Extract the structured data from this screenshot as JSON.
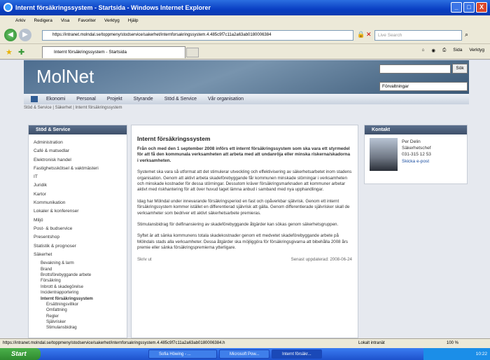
{
  "window": {
    "title": "Internt försäkringssystem - Startsida - Windows Internet Explorer",
    "buttons": [
      "_",
      "□",
      "X"
    ]
  },
  "menu": [
    "Arkiv",
    "Redigera",
    "Visa",
    "Favoriter",
    "Verktyg",
    "Hjälp"
  ],
  "address": {
    "url": "https://intranet.molndal.se/toppmeny/stodservice/sakerhet/internforsakringssystem.4.485c9f7c11a2a63ab0180006384",
    "search_placeholder": "Live Search"
  },
  "tab": {
    "title": "Internt försäkringssystem - Startsida"
  },
  "tools": [
    "Sida",
    "Verktyg"
  ],
  "site": {
    "logo": "MolNet",
    "search_button": "Sök",
    "dropdown": "Förvaltningar",
    "nav": [
      "Ekonomi",
      "Personal",
      "Projekt",
      "Styrande",
      "Stöd & Service",
      "Vår organisation"
    ],
    "breadcrumb": "Stöd & Service | Säkerhet | Internt försäkringssystem"
  },
  "left": {
    "heading": "Stöd & Service",
    "items": [
      "Administration",
      "Café & matsedlar",
      "Elektronisk handel",
      "Fastighetsskötsel & vaktmästeri",
      "IT",
      "Juridik",
      "Kartor",
      "Kommunikation",
      "Lokaler & konferenser",
      "Miljö",
      "Post- & budservice",
      "Presentshop",
      "Statistik & prognoser",
      "Säkerhet"
    ],
    "sub": [
      "Bevakning & larm",
      "Brand",
      "Brottsförebyggande arbete",
      "Försäkring",
      "Inbrott & skadegörelse",
      "Incidentrapportering",
      "Internt försäkringssystem"
    ],
    "sub2": [
      "Ersättningsvillkor",
      "Omfattning",
      "Regler",
      "Självrisker",
      "Stimulansbidrag"
    ]
  },
  "article": {
    "title": "Internt försäkringssystem",
    "p1": "Från och med den 1 september 2008 införs ett internt försäkringssystem som ska vara ett styrmedel för att få den kommunala verksamheten att arbeta med att undanröja eller minska riskerna/skadorna i verksamheten.",
    "p2": "Systemet ska vara så utformat att det stimulerar utveckling och effektivisering av säkerhetsarbetet inom stadens organisation. Genom att aktivt arbeta skadeförebyggande får kommunen minskade störningar i verksamheten och minskade kostnader för dessa störningar. Dessutom kräver försäkringsmarknaden att kommuner arbetar aktivt med riskhantering för att över huvud taget lämna anbud i samband med nya upphandlingar.",
    "p3": "Idag har Mölndal under innevarande försäkringsperiod en fast och opåverkbar självrisk. Genom ett internt försäkringssystem kommer istället en differentierad självrisk att gälla. Genom differentierade självrisker skall de verksamheter som bedriver ett aktivt säkerhetsarbete premieras.",
    "p4": "Stimulansbidrag för delfinansiering av skadeförebyggande åtgärder kan sökas genom säkerhetsgruppen.",
    "p5": "Syftet är att sänka kommunens totala skadekostnader genom ett medvetet skadeförebyggande arbete på Mölndals stads alla verksamheter. Dessa åtgärder ska möjliggöra för försäkringsgivarna att bibehålla 2008 års premie eller sänka försäkringspremierna ytterligare.",
    "print": "Skriv ut",
    "updated": "Senast uppdaterad: 2008-06-24"
  },
  "contact": {
    "heading": "Kontakt",
    "name": "Per Delin",
    "role": "Säkerhetschef",
    "phone": "031-315 12 53",
    "email": "Skicka e-post"
  },
  "status": {
    "url": "https://intranet.molndal.se/toppmeny/stodservice/sakerhet/internforsakringssystem.4.485c9f7c11a2a63ab0180006384.h",
    "zone": "Lokalt intranät",
    "zoom": "100 %"
  },
  "taskbar": {
    "start": "Start",
    "items": [
      "Sofia Höwing - ...",
      "Microsoft Pow...",
      "Internt försäkr..."
    ],
    "clock": "10:22"
  }
}
